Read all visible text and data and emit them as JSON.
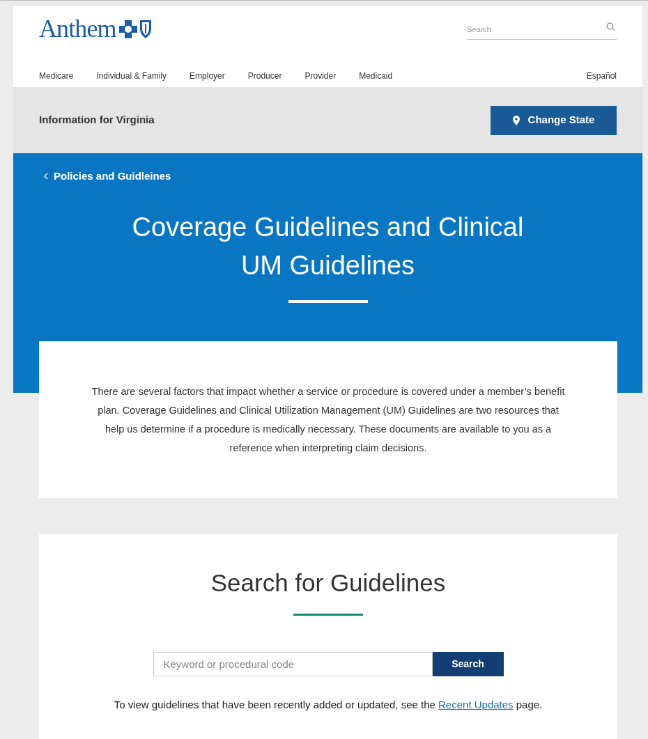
{
  "header": {
    "logo_text": "Anthem",
    "search": {
      "placeholder": "Search"
    },
    "nav": [
      {
        "label": "Medicare"
      },
      {
        "label": "Individual & Family"
      },
      {
        "label": "Employer"
      },
      {
        "label": "Producer"
      },
      {
        "label": "Provider"
      },
      {
        "label": "Medicaid"
      }
    ],
    "language_link": "Español"
  },
  "state_bar": {
    "label": "Information for Virginia",
    "button": "Change State"
  },
  "hero": {
    "back_link": "Policies and Guidleines",
    "title": "Coverage Guidelines and Clinical UM Guidelines"
  },
  "intro": "There are several factors that impact whether a service or procedure is covered under a member’s benefit plan. Coverage Guidelines and Clinical Utilization Management (UM) Guidelines are two resources that help us determine if a procedure is medically necessary. These documents are available to you as a reference when interpreting claim decisions.",
  "search_section": {
    "title": "Search for Guidelines",
    "field": {
      "placeholder": "Keyword or procedural code"
    },
    "button": "Search",
    "note": {
      "before": "To view guidelines that have been recently added or updated, see the",
      "link": "Recent Updates",
      "after": "page."
    }
  }
}
